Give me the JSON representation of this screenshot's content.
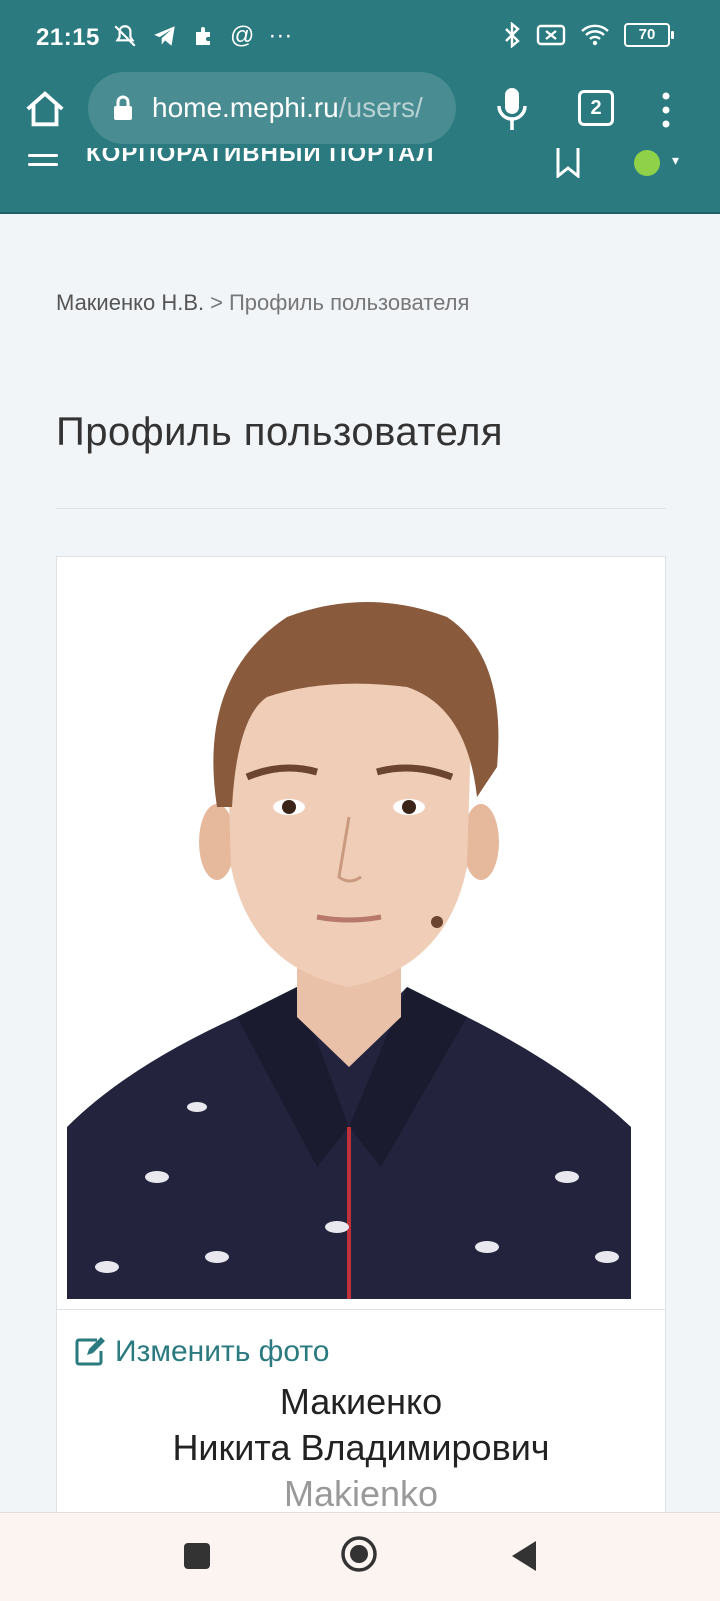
{
  "status_bar": {
    "time": "21:15",
    "battery": "70"
  },
  "browser": {
    "url_host": "home.mephi.ru",
    "url_path": "/users/",
    "tab_count": "2"
  },
  "portal": {
    "title": "КОРПОРАТИВНЫЙ ПОРТАЛ"
  },
  "breadcrumb": {
    "parent": "Макиенко Н.В.",
    "separator": ">",
    "current": "Профиль пользователя"
  },
  "page": {
    "title": "Профиль пользователя"
  },
  "profile": {
    "edit_photo_label": "Изменить фото",
    "last_name": "Макиенко",
    "first_middle_name": "Никита Владимирович",
    "latin_name": "Makienko"
  },
  "colors": {
    "accent": "#2a7a80",
    "status_online": "#8fd24a"
  }
}
